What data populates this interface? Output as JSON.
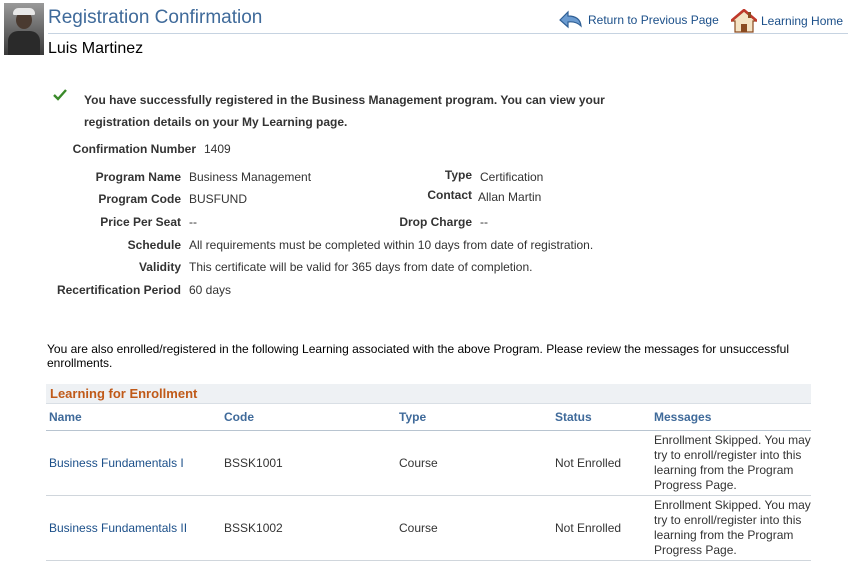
{
  "header": {
    "title": "Registration Confirmation",
    "user_name": "Luis Martinez",
    "return_label": "Return to Previous Page",
    "home_label": "Learning Home"
  },
  "success": {
    "icon": "checkmark-icon",
    "message": "You have successfully registered in the Business Management program. You can view your registration details on your My Learning page."
  },
  "details": {
    "confirmation_label": "Confirmation Number",
    "confirmation_value": "1409",
    "program_name_label": "Program Name",
    "program_name_value": "Business Management",
    "program_code_label": "Program Code",
    "program_code_value": "BUSFUND",
    "price_label": "Price Per Seat",
    "price_value": "--",
    "schedule_label": "Schedule",
    "schedule_value": "All requirements must be completed within 10 days from date of registration.",
    "validity_label": "Validity",
    "validity_value": "This certificate will be valid for 365 days from date of completion.",
    "recert_label": "Recertification Period",
    "recert_value": "60 days",
    "type_label": "Type",
    "type_value": "Certification",
    "contact_label": "Contact",
    "contact_value": "Allan Martin",
    "drop_label": "Drop Charge",
    "drop_value": "--"
  },
  "enroll_note": "You are also enrolled/registered in the following Learning associated with the above Program. Please review the messages for unsuccessful enrollments.",
  "grid": {
    "title": "Learning for Enrollment",
    "columns": [
      "Name",
      "Code",
      "Type",
      "Status",
      "Messages"
    ],
    "rows": [
      {
        "name": "Business Fundamentals I",
        "code": "BSSK1001",
        "type": "Course",
        "status": "Not Enrolled",
        "message": "Enrollment Skipped. You may try to enroll/register into this learning from the Program Progress Page."
      },
      {
        "name": "Business Fundamentals II",
        "code": "BSSK1002",
        "type": "Course",
        "status": "Not Enrolled",
        "message": "Enrollment Skipped. You may try to enroll/register into this learning from the Program Progress Page."
      }
    ]
  },
  "colors": {
    "title": "#3f6a9a",
    "link": "#1b4f89",
    "grid_title": "#c05a19",
    "success_check": "#3a8a2a"
  }
}
